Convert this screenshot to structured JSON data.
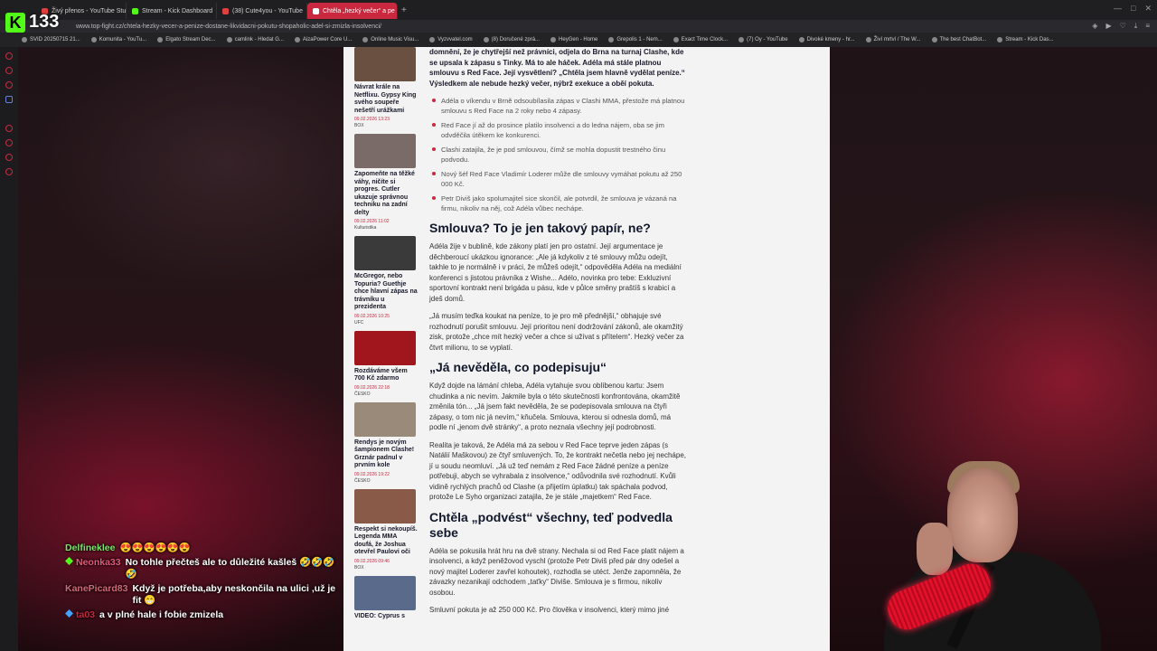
{
  "browser": {
    "tabs": [
      {
        "label": "Živý přenos - YouTube Stu",
        "color": "#e04040",
        "active": false
      },
      {
        "label": "Stream - Kick Dashboard",
        "color": "#53fc18",
        "active": false
      },
      {
        "label": "(38) Cute4you - YouTube",
        "color": "#e04040",
        "active": false
      },
      {
        "label": "Chtěla „hezký večer“ a pe",
        "color": "#ffffff",
        "active": true
      }
    ],
    "url": "www.top-fight.cz/chtela-hezky-vecer-a-penize-dostane-likvidacni-pokutu-shopaholic-adel-si-zmizla-insolvenci/",
    "bookmarks": [
      "SVID 20250715 21...",
      "Komunita - YouTu...",
      "Elgato Stream Dec...",
      "camlink - Hledat G...",
      "AizaPower Core U...",
      "Online Music Visu...",
      "Vyzvvatel.com",
      "(8) Doručené zprá...",
      "HeyGen - Home",
      "Grepolis 1 - Nem...",
      "Exact Time Clock...",
      "(7) Oy - YouTube",
      "Divoké kmeny - hr...",
      "Živí mrtví / The W...",
      "The best ChatBot...",
      "Stream - Kick Das..."
    ]
  },
  "overlay": {
    "logo": "K",
    "viewers": "133"
  },
  "sidebar_cards": [
    {
      "title": "Návrat krále na Netflixu. Gypsy King svého soupeře nešetří urážkami",
      "date": "09.02.2026 13:23",
      "cat": "BOX",
      "img": "#6a5040"
    },
    {
      "title": "Zapomeňte na těžké váhy, ničíte si progres. Cutler ukazuje správnou techniku na zadní delty",
      "date": "09.02.2026 11:02",
      "cat": "Kulturistika",
      "img": "#7a6a68"
    },
    {
      "title": "McGregor, nebo Topuria? Guethje chce hlavní zápas na trávníku u prezidenta",
      "date": "09.02.2026 10:25",
      "cat": "UFC",
      "img": "#3a3a3a"
    },
    {
      "title": "Rozdáváme všem 700 Kč zdarmo",
      "date": "09.02.2026 22:18",
      "cat": "ČESKO",
      "img": "#a0161c"
    },
    {
      "title": "Rendys je novým šampionem Clashe! Grznár padnul v prvním kole",
      "date": "09.02.2026 19:22",
      "cat": "ČESKO",
      "img": "#9a8a7a"
    },
    {
      "title": "Respekt si nekoupíš. Legenda MMA doufá, že Joshua otevřel Paulovi oči",
      "date": "09.02.2026 09:46",
      "cat": "BOX",
      "img": "#8a5a48"
    },
    {
      "title": "VIDEO: Cyprus s",
      "date": "",
      "cat": "",
      "img": "#5a6a8a"
    }
  ],
  "article": {
    "intro": "domnění, že je chytřejší než právníci, odjela do Brna na turnaj Clashe, kde se upsala k zápasu s Tinky. Má to ale háček. Adéla má stále platnou smlouvu s Red Face. Její vysvětlení? „Chtěla jsem hlavně vydělat peníze.“ Výsledkem ale nebude hezký večer, nýbrž exekuce a oběí pokuta.",
    "bullets": [
      "Adéla o víkendu v Brně odsoubílasila zápas v Clashi MMA, přestože má platnou smlouvu s Red Face na 2 roky nebo 4 zápasy.",
      "Red Face jí až do prosince platilo insolvenci a do ledna nájem, oba se jim odvděčila útěkem ke konkurenci.",
      "Clashi zatajila, že je pod smlouvou, čímž se mohla dopustit trestného činu podvodu.",
      "Nový šéf Red Face Vladimír Loderer může dle smlouvy vymáhat pokutu až 250 000 Kč.",
      "Petr Diviš jako spolumajitel sice skončil, ale potvrdil, že smlouva je vázaná na firmu, nikoliv na něj, což Adéla vůbec nechápe."
    ],
    "h1": "Smlouva? To je jen takový papír, ne?",
    "p1": "Adéla žije v bublině, kde zákony platí jen pro ostatní. Její argumentace je děchberoucí ukázkou ignorance: „Ale já kdykoliv z té smlouvy můžu odejít, takhle to je normálně i v práci, že můžeš odejít,“ odpověděla Adéla na mediální konferenci s jistotou právníka z Wishe... Adélo, novinka pro tebe: Exkluzivní sportovní kontrakt není brigáda u pásu, kde v půlce směny praštíš s krabicí a jdeš domů.",
    "p2": "„Já musím teďka koukat na peníze, to je pro mě přednější,“ obhajuje své rozhodnutí porušit smlouvu. Její prioritou není dodržování zákonů, ale okamžitý zisk, protože „chce mít hezký večer a chce si užívat s přítelem“. Hezký večer za čtvrt milionu, to se vyplatí.",
    "h2": "„Já nevěděla, co podepisuju“",
    "p3": "Když dojde na lámání chleba, Adéla vytahuje svou oblíbenou kartu: Jsem chudinka a nic nevím. Jakmile byla o této skutečnosti konfrontována, okamžitě změnila tón... „Já jsem fakt nevěděla, že se podepisovala smlouva na čtyři zápasy, o tom nic já nevím,“ kňučela. Smlouva, kterou si odnesla domů, má podle ní „jenom dvě stránky“, a proto neznala všechny její podrobnosti.",
    "p4": "Realita je taková, že Adéla má za sebou v Red Face teprve jeden zápas (s Natálií Maškovou) ze čtyř smluvených. To, že kontrakt nečetla nebo jej nechápe, jí u soudu neomluví. „Já už teď nemám z Red Face žádné peníze a peníze potřebuji, abych se vyhrabala z insolvence,“ odůvodnila své rozhodnutí. Kvůli vidině rychlých prachů od Clashe (a přijetím úplatku) tak spáchala podvod, protože Le Syho organizaci zatajila, že je stále „majetkem“ Red Face.",
    "h3": "Chtěla „podvést“ všechny, teď podvedla sebe",
    "p5": "Adéla se pokusila hrát hru na dvě strany. Nechala si od Red Face platit nájem a insolvenci, a když peněžovod vyschl (protože Petr Diviš před pár dny odešel a nový majitel Loderer zavřel kohoutek), rozhodla se utéct. Jenže zapomněla, že závazky nezanikají odchodem „taťky“ Diviše. Smlouva je s firmou, nikoliv osobou.",
    "p6": "Smluvní pokuta je až 250 000 Kč. Pro člověka v insolvenci, který mimo jiné"
  },
  "chat": [
    {
      "user": "Delfineklee",
      "text": "😍😍😍😍😍😍",
      "cls": "",
      "badge": ""
    },
    {
      "user": "Neonka33",
      "text": "No tohle přečteš ale to důležité kašleš 🤣🤣🤣🤣",
      "cls": "alt",
      "badge": "green"
    },
    {
      "user": "KanePicard83",
      "text": "Když je potřeba,aby neskončila na ulici ,už je fit 😁",
      "cls": "alt2",
      "badge": ""
    },
    {
      "user": "ta03",
      "text": "a v plné hale i fobie zmizela",
      "cls": "alt3",
      "badge": "blue"
    }
  ]
}
